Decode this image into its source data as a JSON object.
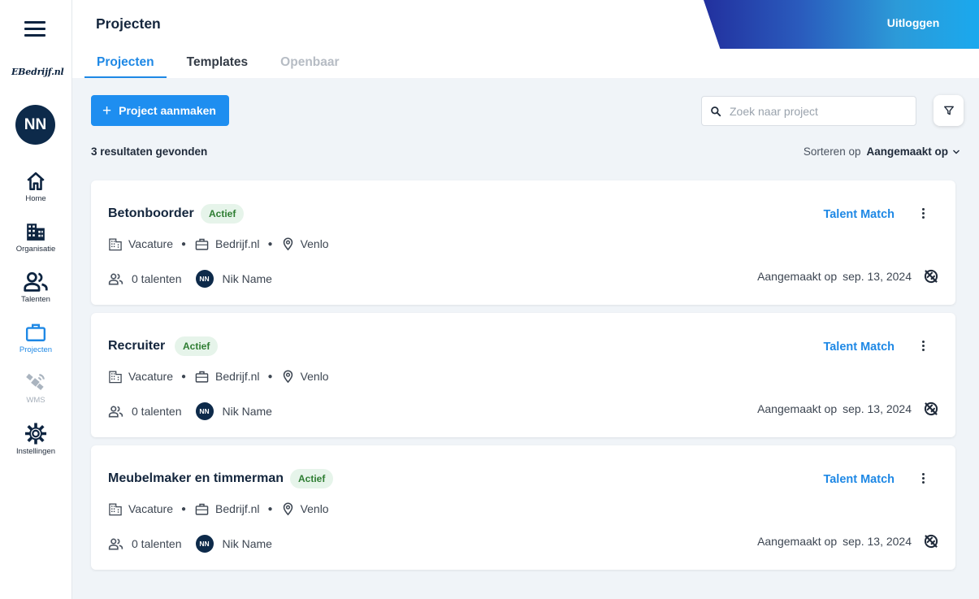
{
  "sidebar": {
    "logo_text": "EBedrijf.nl",
    "avatar_initials": "NN",
    "items": [
      {
        "label": "Home",
        "icon": "home-icon"
      },
      {
        "label": "Organisatie",
        "icon": "building-icon"
      },
      {
        "label": "Talenten",
        "icon": "people-icon"
      },
      {
        "label": "Projecten",
        "icon": "briefcase-icon",
        "active": true
      },
      {
        "label": "WMS",
        "icon": "satellite-icon",
        "disabled": true
      },
      {
        "label": "Instellingen",
        "icon": "gear-icon"
      }
    ]
  },
  "header": {
    "title": "Projecten",
    "logout_label": "Uitloggen",
    "tabs": [
      {
        "label": "Projecten",
        "active": true
      },
      {
        "label": "Templates"
      },
      {
        "label": "Openbaar",
        "disabled": true
      }
    ]
  },
  "toolbar": {
    "create_label": "Project aanmaken",
    "search_placeholder": "Zoek naar project",
    "results_text": "3 resultaten gevonden",
    "sort_label": "Sorteren op",
    "sort_value": "Aangemaakt op"
  },
  "projects": [
    {
      "title": "Betonboorder",
      "status": "Actief",
      "type": "Vacature",
      "company": "Bedrijf.nl",
      "location": "Venlo",
      "talents": "0 talenten",
      "owner_initials": "NN",
      "owner_name": "Nik Name",
      "talent_match": "Talent Match",
      "created_label": "Aangemaakt op",
      "created_date": "sep. 13, 2024"
    },
    {
      "title": "Recruiter",
      "status": "Actief",
      "type": "Vacature",
      "company": "Bedrijf.nl",
      "location": "Venlo",
      "talents": "0 talenten",
      "owner_initials": "NN",
      "owner_name": "Nik Name",
      "talent_match": "Talent Match",
      "created_label": "Aangemaakt op",
      "created_date": "sep. 13, 2024"
    },
    {
      "title": "Meubelmaker en timmerman",
      "status": "Actief",
      "type": "Vacature",
      "company": "Bedrijf.nl",
      "location": "Venlo",
      "talents": "0 talenten",
      "owner_initials": "NN",
      "owner_name": "Nik Name",
      "talent_match": "Talent Match",
      "created_label": "Aangemaakt op",
      "created_date": "sep. 13, 2024"
    }
  ],
  "colors": {
    "accent": "#1e88e5",
    "navy": "#0d2a4a",
    "status_green": "#2e7d32",
    "status_bg": "#e6f4ea"
  }
}
